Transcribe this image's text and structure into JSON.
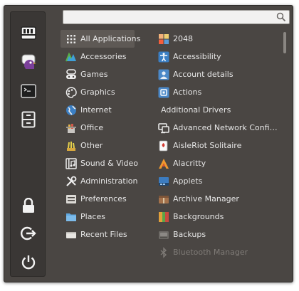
{
  "search": {
    "value": "",
    "placeholder": ""
  },
  "favorites": [
    {
      "icon": "folder-drive-icon",
      "label": ""
    },
    {
      "icon": "pidgin-icon",
      "label": ""
    },
    {
      "icon": "terminal-icon",
      "label": ""
    },
    {
      "icon": "file-cabinet-icon",
      "label": ""
    }
  ],
  "session": [
    {
      "icon": "lock-icon"
    },
    {
      "icon": "logout-icon"
    },
    {
      "icon": "power-icon"
    }
  ],
  "categories": [
    {
      "label": "All Applications",
      "icon": "grid-icon",
      "selected": true
    },
    {
      "label": "Accessories",
      "icon": "accessories-icon"
    },
    {
      "label": "Games",
      "icon": "gamepad-icon"
    },
    {
      "label": "Graphics",
      "icon": "palette-icon"
    },
    {
      "label": "Internet",
      "icon": "globe-icon"
    },
    {
      "label": "Office",
      "icon": "office-icon"
    },
    {
      "label": "Other",
      "icon": "other-icon"
    },
    {
      "label": "Sound & Video",
      "icon": "sound-video-icon"
    },
    {
      "label": "Administration",
      "icon": "tools-icon"
    },
    {
      "label": "Preferences",
      "icon": "preferences-icon"
    },
    {
      "label": "Places",
      "icon": "folder-icon"
    },
    {
      "label": "Recent Files",
      "icon": "recent-files-icon"
    }
  ],
  "apps": [
    {
      "label": "2048",
      "icon": "2048-icon"
    },
    {
      "label": "Accessibility",
      "icon": "accessibility-icon"
    },
    {
      "label": "Account details",
      "icon": "account-icon"
    },
    {
      "label": "Actions",
      "icon": "actions-icon"
    },
    {
      "label": "Additional Drivers",
      "icon": "",
      "heading": true
    },
    {
      "label": "Advanced Network Configur…",
      "icon": "network-icon"
    },
    {
      "label": "AisleRiot Solitaire",
      "icon": "cards-icon"
    },
    {
      "label": "Alacritty",
      "icon": "alacritty-icon"
    },
    {
      "label": "Applets",
      "icon": "applets-icon"
    },
    {
      "label": "Archive Manager",
      "icon": "archive-icon"
    },
    {
      "label": "Backgrounds",
      "icon": "backgrounds-icon"
    },
    {
      "label": "Backups",
      "icon": "backups-icon"
    },
    {
      "label": "Bluetooth Manager",
      "icon": "bluetooth-icon",
      "faded": true
    }
  ],
  "colors": {
    "menu_bg": "#4a4643",
    "sidebar_bg": "#3a3735",
    "text": "#e6e6e6",
    "selected_bg": "#5e5955"
  }
}
